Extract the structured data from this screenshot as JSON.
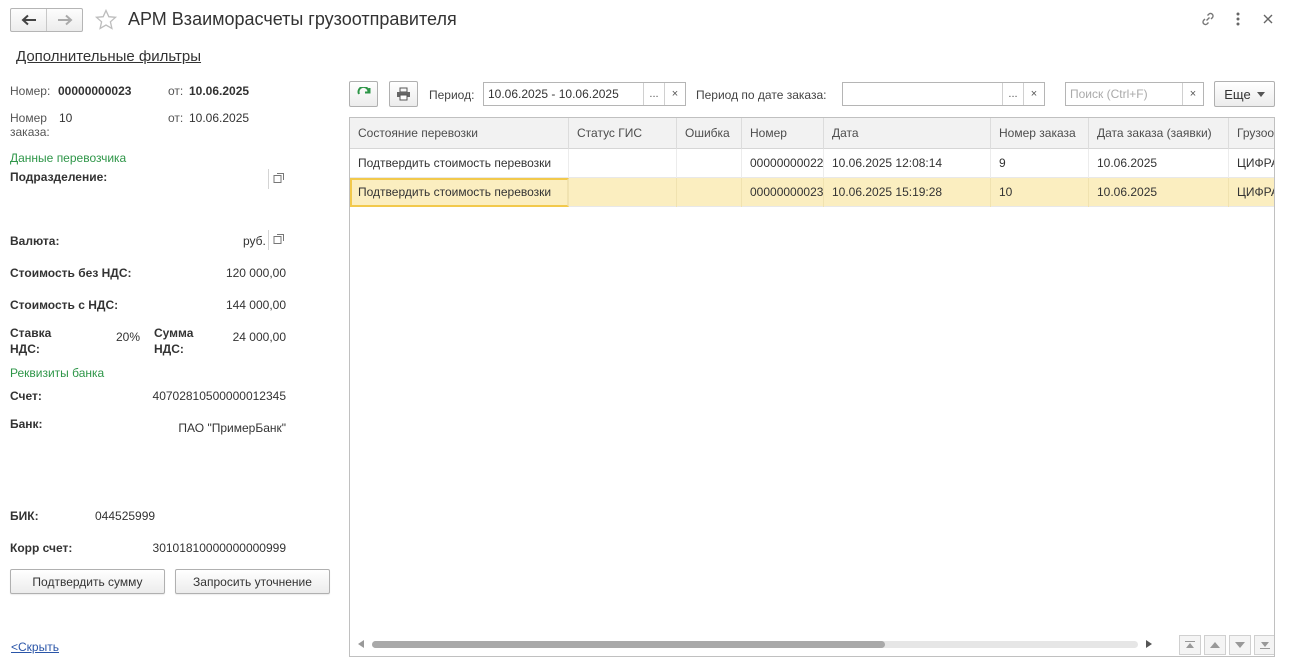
{
  "window": {
    "title": "АРМ Взаиморасчеты грузоотправителя",
    "back_icon": "arrow-left-icon",
    "forward_icon": "arrow-right-icon",
    "favorite_icon": "star-icon",
    "link_icon": "link-icon",
    "menu_icon": "more-vertical-icon",
    "close_icon": "close-icon"
  },
  "filters_link": "Дополнительные фильтры",
  "left": {
    "number_label": "Номер:",
    "number_value": "00000000023",
    "from_label": "от:",
    "from_value": "10.06.2025",
    "order_number_label_1": "Номер",
    "order_number_label_2": "заказа:",
    "order_number_value": "10",
    "order_from_label": "от:",
    "order_from_value": "10.06.2025",
    "carrier_section": "Данные перевозчика",
    "division_label": "Подразделение:",
    "division_value": "",
    "currency_label": "Валюта:",
    "currency_value": "руб.",
    "cost_no_vat_label": "Стоимость без НДС:",
    "cost_no_vat_value": "120 000,00",
    "cost_vat_label": "Стоимость с НДС:",
    "cost_vat_value": "144 000,00",
    "vat_rate_label_1": "Ставка",
    "vat_rate_label_2": "НДС:",
    "vat_rate_value": "20%",
    "vat_sum_label_1": "Сумма",
    "vat_sum_label_2": "НДС:",
    "vat_sum_value": "24 000,00",
    "bank_section": "Реквизиты банка",
    "account_label": "Счет:",
    "account_value": "40702810500000012345",
    "bank_label": "Банк:",
    "bank_value": "ПАО \"ПримерБанк\"",
    "bik_label": "БИК:",
    "bik_value": "044525999",
    "corr_label": "Корр счет:",
    "corr_value": "30101810000000000999",
    "confirm_button": "Подтвердить сумму",
    "clarify_button": "Запросить уточнение",
    "hide_link": "<Скрыть"
  },
  "toolbar": {
    "refresh_icon": "refresh-icon",
    "print_icon": "printer-icon",
    "period_label": "Период:",
    "period_value": "10.06.2025 - 10.06.2025",
    "period_by_order_label": "Период по дате заказа:",
    "period_by_order_value": "",
    "search_placeholder": "Поиск (Ctrl+F)",
    "more_button": "Еще",
    "ellipsis": "...",
    "clear": "×"
  },
  "table": {
    "columns": [
      "Состояние перевозки",
      "Статус ГИС",
      "Ошибка",
      "Номер",
      "Дата",
      "Номер заказа",
      "Дата заказа (заявки)",
      "Грузоотправитель"
    ],
    "rows": [
      [
        "Подтвердить стоимость перевозки",
        "",
        "",
        "00000000022",
        "10.06.2025 12:08:14",
        "9",
        "10.06.2025",
        "ЦИФРА"
      ],
      [
        "Подтвердить стоимость перевозки",
        "",
        "",
        "00000000023",
        "10.06.2025 15:19:28",
        "10",
        "10.06.2025",
        "ЦИФРА"
      ]
    ],
    "selected_row": 1,
    "horizontal_scroll_fraction": 0.67
  }
}
